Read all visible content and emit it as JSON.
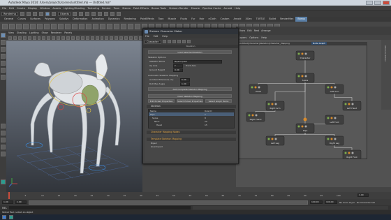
{
  "title_bar": {
    "title": "Autodesk Maya 2014: /Users/projects/scenes/untitled.mb  ---  Untitled.ma*"
  },
  "menu_bar": {
    "items": [
      "File",
      "Edit",
      "Create",
      "Display",
      "Window",
      "Assets",
      "Lighting/Shading",
      "Texturing",
      "Render",
      "Toon",
      "Stereo",
      "Paint Effects",
      "Bonus Tools",
      "Sixteen Render",
      "Muscle",
      "Pipeline Cache",
      "Arnold",
      "Help"
    ]
  },
  "status_line": {
    "mode": "Rendering",
    "objects_label": "Objects"
  },
  "shelf_tabs": [
    "General",
    "Curves",
    "Surfaces",
    "Polygons",
    "Subdivs",
    "Deformation",
    "Animation",
    "Dynamics",
    "Rendering",
    "PaintEffects",
    "Toon",
    "Muscle",
    "Fluids",
    "Fur",
    "Hair",
    "nCloth",
    "Custom",
    "Arnold",
    "XGen",
    "TURTLE",
    "Bullet",
    "RenderMan",
    "Bonus"
  ],
  "shelf_active_tab": "Bonus",
  "viewport_menu": [
    "View",
    "Shading",
    "Lighting",
    "Show",
    "Renderer",
    "Panels"
  ],
  "character_window": {
    "title": "Sixteen Character Maker",
    "menu": [
      "File",
      "Edit",
      "Help"
    ],
    "node_type": "Character",
    "bar_label": "Skeleton",
    "buttons": {
      "load": "Load Selected Skeleton",
      "auto_map": "Add Complete Skeleton Mapping",
      "clear": "Clear Skeleton Mapping",
      "edit_props": "Edit Picked Properties",
      "select_props": "Select Picked Properties",
      "select_nodes": "Select Graph Items"
    },
    "labels": {
      "skeleton_options": "Skeleton Options",
      "skeleton_mode": "Skeleton Mode",
      "skeleton_mode_value": "Biped Quad",
      "up_axis": "Up Axis",
      "front_axis": "Front Axis",
      "up_axis_value": "Y",
      "ground_height": "Ground Height",
      "ground_value": "0.00",
      "auto_mapping": "Automatic Skeleton Mapping",
      "accident_tolerance": "Accident Tolerance (%)",
      "accident_value": "5.00",
      "roll_angle": "Roll Max Angle",
      "roll_value": "1.00"
    },
    "sections": [
      "Skeleton",
      "Character Mapping Nodes",
      "Template Skeleton Mapping"
    ],
    "tree_header": [
      "Name",
      "Role ID"
    ],
    "tree_rows": [
      {
        "name": "Hips",
        "id": "1"
      },
      {
        "name": "Spine",
        "id": "8"
      },
      {
        "name": "Neck",
        "id": "20"
      },
      {
        "name": "Head",
        "id": "15"
      }
    ],
    "template_rows": [
      "Biped",
      "Quadruped"
    ]
  },
  "graph_bar": {
    "path": "|Untitled|Character|Skeleton|Character_Mapping",
    "tag": "Node Graph"
  },
  "right_panel": {
    "header": [
      "Show",
      "Edit",
      "Rest",
      "Arrange"
    ],
    "tabs": [
      "Layers",
      "Options",
      "Help"
    ],
    "side_tabs": [
      "Attribute Editor",
      "Channel Box / Layer Editor"
    ]
  },
  "graph_nodes": [
    {
      "label": "Character",
      "role": "root"
    },
    {
      "label": "Spine",
      "role": "spine"
    },
    {
      "label": "Head",
      "role": "head"
    },
    {
      "label": "Left Arm",
      "role": "arm"
    },
    {
      "label": "Left Hand",
      "role": "hand"
    },
    {
      "label": "Right Arm",
      "role": "arm"
    },
    {
      "label": "Right Hand",
      "role": "hand"
    },
    {
      "label": "Hips",
      "role": "hips"
    },
    {
      "label": "Left Leg",
      "role": "leg"
    },
    {
      "label": "Left Foot",
      "role": "foot"
    },
    {
      "label": "Right Leg",
      "role": "leg"
    },
    {
      "label": "Right Foot",
      "role": "foot"
    }
  ],
  "timeline": {
    "ticks": [
      "1",
      "5",
      "10",
      "15",
      "20",
      "25",
      "30",
      "35",
      "40",
      "45",
      "50",
      "55",
      "60",
      "65",
      "70",
      "75",
      "80",
      "85",
      "90",
      "95",
      "100"
    ],
    "current_frame": "1.00",
    "start": "1.00",
    "end": "100.00",
    "range_start": "1.00",
    "range_end": "100.00",
    "anim_layer": "No Anim Layer",
    "char_set": "No Character Set"
  },
  "command_line": {
    "label": "MEL"
  },
  "help_line": {
    "text": "Select Tool: select an object"
  },
  "colors": {
    "accent": "#5a7fa6",
    "node_green": "#7fae4e",
    "node_orange": "#d98b2c",
    "graph_bg": "#585858"
  }
}
